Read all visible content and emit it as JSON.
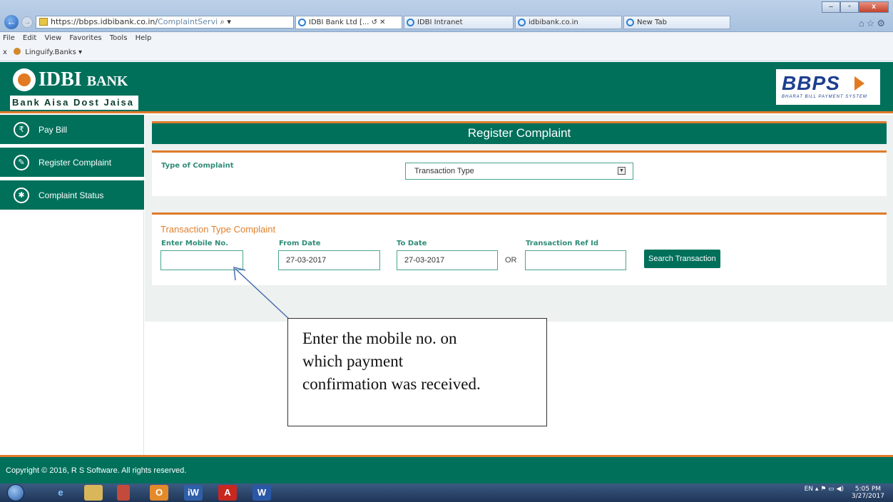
{
  "browser": {
    "address_main": "https://bbps.idbibank.co.in/",
    "address_path": "ComplaintServi",
    "address_suffix": "⌕ ▾",
    "tabs": [
      {
        "label": "IDBI Bank Ltd [... ↺ ✕"
      },
      {
        "label": "IDBI Intranet"
      },
      {
        "label": "idbibank.co.in"
      },
      {
        "label": "New Tab"
      }
    ],
    "menu": [
      "File",
      "Edit",
      "View",
      "Favorites",
      "Tools",
      "Help"
    ],
    "favorites_close": "x",
    "favorites_item": "Linguify.Banks",
    "favorites_caret": "▾",
    "window_controls": {
      "minimize": "–",
      "maximize": "▫",
      "close": "x"
    }
  },
  "header": {
    "bank_name": "IDBI",
    "bank_name_suffix": "BANK",
    "tagline": "Bank Aisa Dost Jaisa",
    "bbps_logo": "BBPS",
    "bbps_sub": "BHARAT BILL PAYMENT SYSTEM"
  },
  "sidebar": {
    "items": [
      {
        "label": "Pay Bill",
        "icon": "rupee-icon",
        "glyph": "₹"
      },
      {
        "label": "Register Complaint",
        "icon": "edit-icon",
        "glyph": "✎"
      },
      {
        "label": "Complaint Status",
        "icon": "gear-icon",
        "glyph": "✱"
      }
    ]
  },
  "main": {
    "title": "Register Complaint",
    "type_label": "Type of Complaint",
    "type_value": "Transaction Type",
    "section_title": "Transaction Type Complaint",
    "mobile_label": "Enter Mobile No.",
    "mobile_value": "",
    "from_label": "From Date",
    "from_value": "27-03-2017",
    "to_label": "To Date",
    "to_value": "27-03-2017",
    "or_text": "OR",
    "ref_label": "Transaction Ref Id",
    "ref_value": "",
    "search_button": "Search Transaction"
  },
  "callout": {
    "line1": "Enter the mobile no. on",
    "line2": "which payment",
    "line3": "confirmation was received."
  },
  "footer": {
    "copyright": "Copyright © 2016, R S Software. All rights reserved."
  },
  "taskbar": {
    "lang": "EN",
    "time": "5:05 PM",
    "date": "3/27/2017"
  },
  "colors": {
    "brand_green": "#00705b",
    "accent_orange": "#e07b2a",
    "label_teal": "#2f8c78"
  }
}
